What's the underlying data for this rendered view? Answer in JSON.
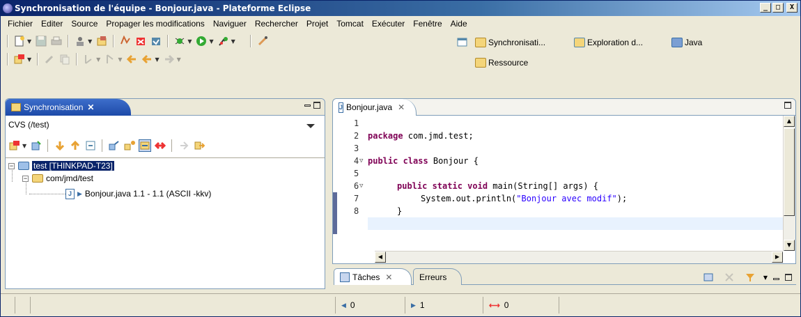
{
  "window": {
    "title": "Synchronisation de l'équipe - Bonjour.java - Plateforme Eclipse",
    "buttons": [
      "_",
      "□",
      "X"
    ]
  },
  "menu": [
    "Fichier",
    "Editer",
    "Source",
    "Propager les modifications",
    "Naviguer",
    "Rechercher",
    "Projet",
    "Tomcat",
    "Exécuter",
    "Fenêtre",
    "Aide"
  ],
  "toolbar": {
    "row1": [
      "new-icon",
      "save-icon",
      "print-icon",
      "cut-icon",
      "team-icon",
      "sync-icon",
      "commit-icon",
      "update-icon",
      "debug-icon",
      "run-icon",
      "external-tools-icon",
      "pin-icon"
    ],
    "row2": [
      "sync-view-icon",
      "edit-icon",
      "copy-icon",
      "prev-icon",
      "next-icon",
      "back-icon",
      "forward-icon"
    ]
  },
  "perspectives": {
    "items": [
      {
        "label": "Synchronisati..."
      },
      {
        "label": "Exploration d..."
      },
      {
        "label": "Java"
      },
      {
        "label": "Ressource"
      }
    ]
  },
  "sync_view": {
    "tab_label": "Synchronisation",
    "tab_close": "✕",
    "repository": "CVS (/test)",
    "tree": {
      "project": "test  [THINKPAD-T23]",
      "folder": "com/jmd/test",
      "file": "Bonjour.java 1.1 - 1.1 (ASCII -kkv)"
    }
  },
  "editor": {
    "tab_label": "Bonjour.java",
    "lines": [
      {
        "num": "1",
        "text": ""
      },
      {
        "num": "2",
        "kw": "package",
        "text": " com.jmd.test;"
      },
      {
        "num": "3",
        "text": ""
      },
      {
        "num": "4",
        "kw": "public class",
        "text": " Bonjour {"
      },
      {
        "num": "5",
        "text": ""
      },
      {
        "num": "6",
        "kw": "public static void",
        "text": " main(String[] args) {"
      },
      {
        "num": "7",
        "pre": "System.out.println(",
        "str": "\"Bonjour avec modif\"",
        "post": ");"
      },
      {
        "num": "8",
        "text": "}"
      }
    ]
  },
  "tasks_view": {
    "tab_tasks": "Tâches",
    "tab_errors": "Erreurs"
  },
  "status": {
    "incoming": "0",
    "outgoing": "1",
    "conflicts": "0"
  },
  "colors": {
    "keyword": "#7f0055",
    "string": "#2a00ff",
    "selection": "#0a246a",
    "title_bar": "#0a246a"
  }
}
